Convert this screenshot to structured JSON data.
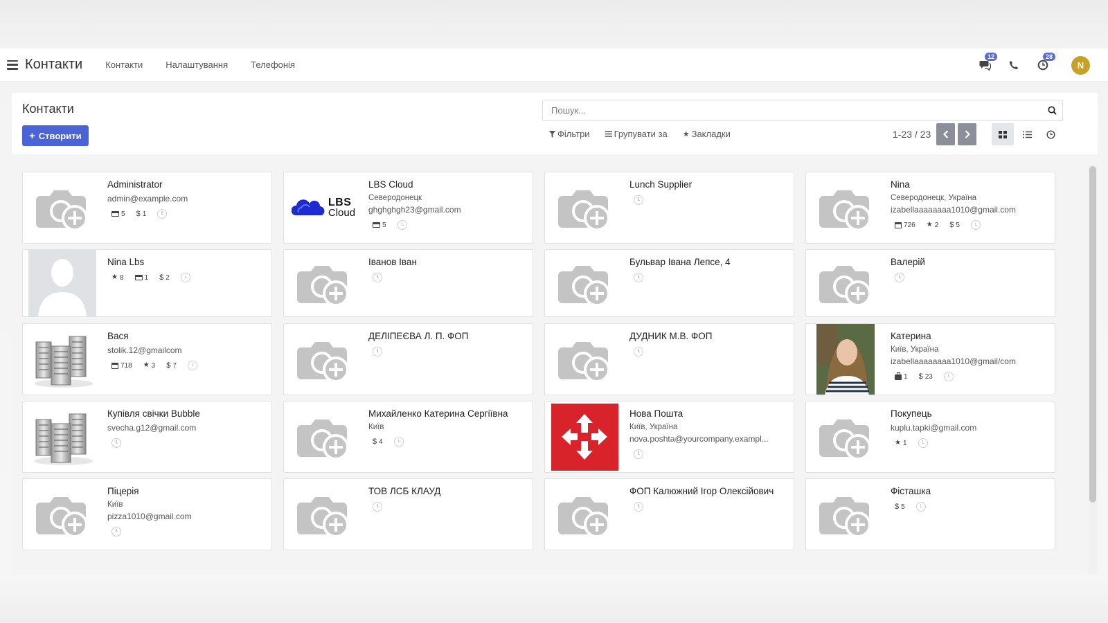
{
  "navbar": {
    "app_title": "Контакти",
    "menu": [
      "Контакти",
      "Налаштування",
      "Телефонія"
    ],
    "chat_badge": "12",
    "activity_badge": "28",
    "user_initial": "N",
    "user_avatar_color": "#c9a027"
  },
  "control": {
    "breadcrumb": "Контакти",
    "create_label": "Створити",
    "search_placeholder": "Пошук...",
    "filters_label": "Фільтри",
    "group_label": "Групувати за",
    "favorites_label": "Закладки",
    "pager_value": "1-23 / 23",
    "accent_color": "#4a63d6"
  },
  "cards": [
    {
      "name": "Administrator",
      "lines": [
        "admin@example.com"
      ],
      "image": "placeholder-camera-icon",
      "stats": [
        {
          "icon": "card-icon",
          "value": "5"
        },
        {
          "icon": "dollar",
          "value": "1"
        }
      ]
    },
    {
      "name": "LBS Cloud",
      "lines": [
        "Северодонецк",
        "ghghghgh23@gmail.com"
      ],
      "image": "lbs-cloud-logo",
      "logo_text": [
        "LBS",
        "Cloud"
      ],
      "stats": [
        {
          "icon": "card-icon",
          "value": "5"
        }
      ]
    },
    {
      "name": "Lunch Supplier",
      "lines": [],
      "image": "placeholder-camera-icon",
      "stats": []
    },
    {
      "name": "Nina",
      "lines": [
        "Северодонецк, Україна",
        "izabellaaaaaaaa1010@gmail.com"
      ],
      "image": "placeholder-camera-icon",
      "stats": [
        {
          "icon": "calendar-icon",
          "value": "726"
        },
        {
          "icon": "star",
          "value": "2"
        },
        {
          "icon": "dollar",
          "value": "5"
        }
      ]
    },
    {
      "name": "Nina Lbs",
      "lines": [],
      "image": "person-silhouette",
      "stats": [
        {
          "icon": "star",
          "value": "8"
        },
        {
          "icon": "card-icon",
          "value": "1"
        },
        {
          "icon": "dollar",
          "value": "2"
        }
      ]
    },
    {
      "name": "Іванов Іван",
      "lines": [],
      "image": "placeholder-camera-icon",
      "stats": []
    },
    {
      "name": "Бульвар Івана Лепсе, 4",
      "lines": [],
      "image": "placeholder-camera-icon",
      "stats": []
    },
    {
      "name": "Валерій",
      "lines": [],
      "image": "placeholder-camera-icon",
      "stats": []
    },
    {
      "name": "Вася",
      "lines": [
        "stolik.12@gmailcom"
      ],
      "image": "company-buildings-icon",
      "stats": [
        {
          "icon": "calendar-icon",
          "value": "718"
        },
        {
          "icon": "star",
          "value": "3"
        },
        {
          "icon": "dollar",
          "value": "7"
        }
      ]
    },
    {
      "name": "ДЕЛІПЕЄВА Л. П. ФОП",
      "lines": [],
      "image": "placeholder-camera-icon",
      "stats": []
    },
    {
      "name": "ДУДНИК М.В. ФОП",
      "lines": [],
      "image": "placeholder-camera-icon",
      "stats": []
    },
    {
      "name": "Катерина",
      "lines": [
        "Київ, Україна",
        "izabellaaaaaaaa1010@gmail/com"
      ],
      "image": "woman-photo",
      "stats": [
        {
          "icon": "bag-icon",
          "value": "1"
        },
        {
          "icon": "dollar",
          "value": "23"
        }
      ]
    },
    {
      "name": "Купівля свічки Bubble",
      "lines": [
        "svecha.g12@gmail.com"
      ],
      "image": "company-buildings-icon",
      "stats": []
    },
    {
      "name": "Михайленко Катерина Сергіївна",
      "lines": [
        "Київ"
      ],
      "image": "placeholder-camera-icon",
      "stats": [
        {
          "icon": "dollar",
          "value": "4"
        }
      ]
    },
    {
      "name": "Нова Пошта",
      "lines": [
        "Київ, Україна",
        "nova.poshta@yourcompany.exampl..."
      ],
      "image": "nova-poshta-logo",
      "stats": []
    },
    {
      "name": "Покупець",
      "lines": [
        "kuplu.tapki@gmail.com"
      ],
      "image": "placeholder-camera-icon",
      "stats": [
        {
          "icon": "star",
          "value": "1"
        }
      ]
    },
    {
      "name": "Піцерія",
      "lines": [
        "Київ",
        "pizza1010@gmail.com"
      ],
      "image": "placeholder-camera-icon",
      "stats": []
    },
    {
      "name": "ТОВ ЛСБ КЛАУД",
      "lines": [],
      "image": "placeholder-camera-icon",
      "stats": []
    },
    {
      "name": "ФОП Калюжний Ігор Олексійович",
      "lines": [],
      "image": "placeholder-camera-icon",
      "stats": []
    },
    {
      "name": "Фісташка",
      "lines": [],
      "image": "placeholder-camera-icon",
      "stats": [
        {
          "icon": "dollar",
          "value": "5"
        }
      ]
    }
  ]
}
